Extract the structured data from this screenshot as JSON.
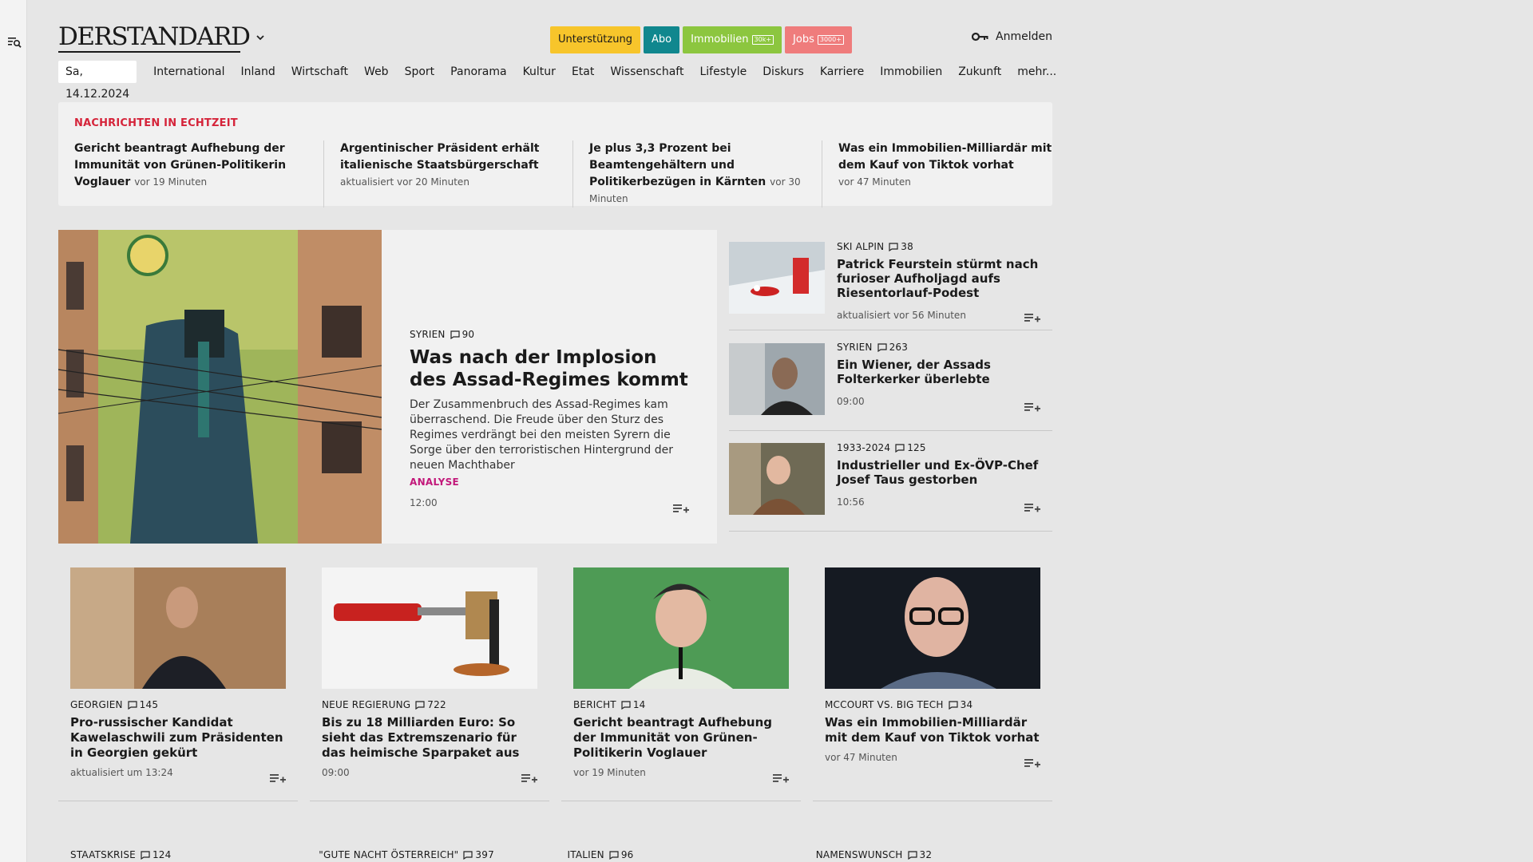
{
  "header": {
    "logo": "DERSTANDARD",
    "pills": [
      {
        "label": "Unterstützung",
        "badge": "",
        "bg": "#f7c52b",
        "fg": "#1a1a1a"
      },
      {
        "label": "Abo",
        "badge": "",
        "bg": "#10878e",
        "fg": "#ffffff"
      },
      {
        "label": "Immobilien",
        "badge": "30k+",
        "bg": "#8cc63f",
        "fg": "#ffffff"
      },
      {
        "label": "Jobs",
        "badge": "3000+",
        "bg": "#ef7c7c",
        "fg": "#ffffff"
      }
    ],
    "login": "Anmelden"
  },
  "nav": {
    "date": "Sa, 14.12.2024",
    "items": [
      "International",
      "Inland",
      "Wirtschaft",
      "Web",
      "Sport",
      "Panorama",
      "Kultur",
      "Etat",
      "Wissenschaft",
      "Lifestyle",
      "Diskurs",
      "Karriere",
      "Immobilien",
      "Zukunft",
      "mehr..."
    ]
  },
  "realtime": {
    "title": "NACHRICHTEN IN ECHTZEIT",
    "items": [
      {
        "title": "Gericht beantragt Aufhebung der Im­munität von Grünen-Politikerin Vog­lauer",
        "time": "vor 19 Minuten"
      },
      {
        "title": "Argentinischer Präsident erhält italie­nische Staatsbürgerschaft",
        "time": "aktualisiert vor 20 Minuten"
      },
      {
        "title": "Je plus 3,3 Prozent bei Beamtenge­hältern und Politikerbezügen in Kärn­ten",
        "time": "vor 30 Minuten"
      },
      {
        "title": "Was ein Immobilien-Milliardär mit dem Kauf von Tiktok vorhat",
        "time": "vor 47 Minuten"
      }
    ]
  },
  "hero": {
    "kicker": "SYRIEN",
    "comments": "90",
    "title": "Was nach der Implosion des Assad-Regimes kommt",
    "teaser": "Der Zusammenbruch des Assad-Regimes kam überraschend. Die Freude über den Sturz des Regimes verdrängt bei den meisten Syrern die Sorge über den terroristischen Hintergrund der neuen Machthaber",
    "label": "ANALYSE",
    "time": "12:00"
  },
  "side": [
    {
      "kicker": "SKI ALPIN",
      "comments": "38",
      "title": "Patrick Feurstein stürmt nach furioser Aufholjagd aufs Riesen­torlauf-Podest",
      "meta": "aktualisiert vor 56 Minuten"
    },
    {
      "kicker": "SYRIEN",
      "comments": "263",
      "title": "Ein Wiener, der Assads Folterkerker überlebte",
      "meta": "09:00"
    },
    {
      "kicker": "1933-2024",
      "comments": "125",
      "title": "Industrieller und Ex-ÖVP-Chef Josef Taus gestorben",
      "meta": "10:56"
    }
  ],
  "cards": [
    {
      "kicker": "GEORGIEN",
      "comments": "145",
      "title": "Pro-russischer Kandidat Kawelaschwili zum Präsidenten in Georgien gekürt",
      "meta": "aktualisiert um 13:24"
    },
    {
      "kicker": "NEUE REGIERUNG",
      "comments": "722",
      "title": "Bis zu 18 Milliarden Euro: So sieht das Extremszenario für das heimische Sparpaket aus",
      "meta": "09:00"
    },
    {
      "kicker": "BERICHT",
      "comments": "14",
      "title": "Gericht beantragt Aufhebung der Immunität von Grünen-Politikerin Voglauer",
      "meta": "vor 19 Minuten"
    },
    {
      "kicker": "MCCOURT VS. BIG TECH",
      "comments": "34",
      "title": "Was ein Immobilien-Milliardär mit dem Kauf von Tiktok vorhat",
      "meta": "vor 47 Minuten"
    }
  ],
  "bottom": [
    {
      "kicker": "STAATSKRISE",
      "comments": "124"
    },
    {
      "kicker": "\"GUTE NACHT ÖSTERREICH\"",
      "comments": "397"
    },
    {
      "kicker": "ITALIEN",
      "comments": "96"
    },
    {
      "kicker": "NAMENSWUNSCH",
      "comments": "32"
    }
  ],
  "icons": {
    "menu": "search-menu-icon",
    "login": "key-icon",
    "comment": "comment-icon",
    "add": "add-to-list-icon"
  }
}
